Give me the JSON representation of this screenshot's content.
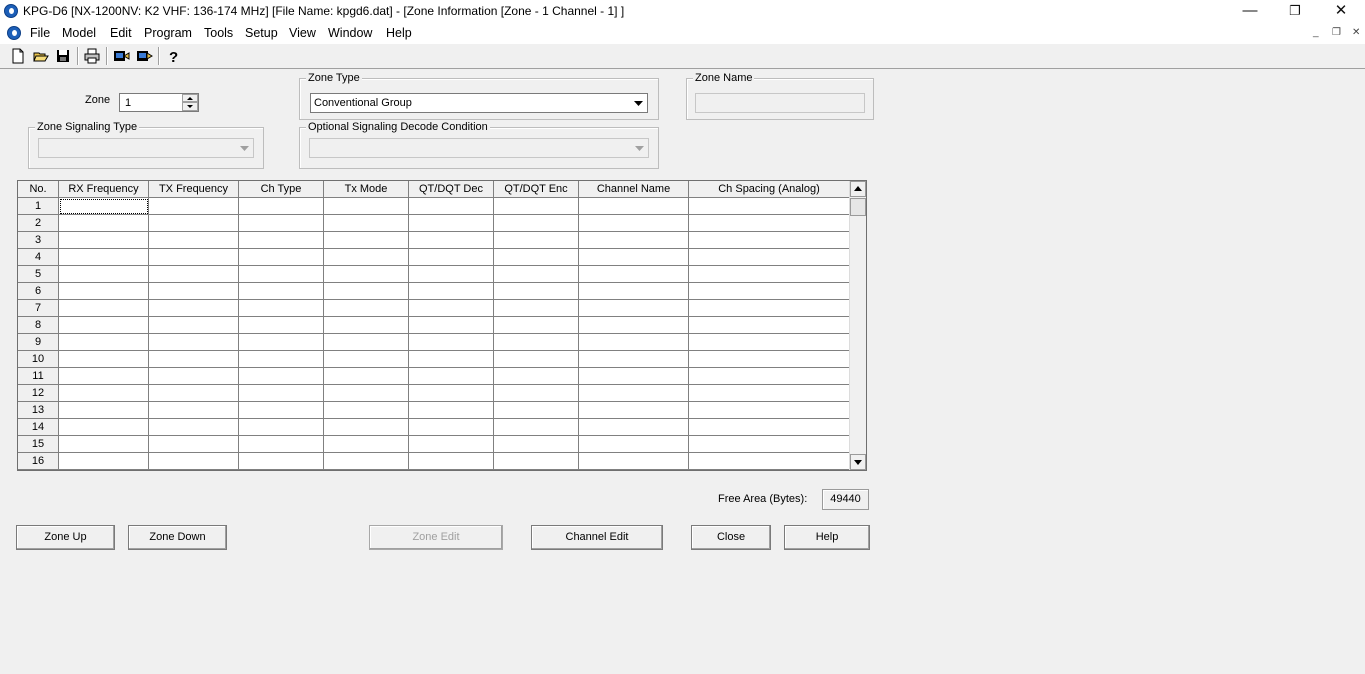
{
  "window": {
    "title": "KPG-D6 [NX-1200NV: K2 VHF: 136-174 MHz] [File Name: kpgd6.dat] - [Zone Information [Zone -  1    Channel   -   1]  ]",
    "minimize": "—",
    "restore": "❐",
    "close": "✕"
  },
  "menu": {
    "items": [
      "File",
      "Model",
      "Edit",
      "Program",
      "Tools",
      "Setup",
      "View",
      "Window",
      "Help"
    ],
    "mdi_minimize": "_",
    "mdi_restore": "❐",
    "mdi_close": "✕"
  },
  "toolbar": {
    "icons": [
      "new-file-icon",
      "open-folder-icon",
      "save-icon",
      "print-icon",
      "read-radio-icon",
      "write-radio-icon",
      "help-pointer-icon"
    ]
  },
  "zone": {
    "label": "Zone",
    "value": "1"
  },
  "zone_type": {
    "legend": "Zone Type",
    "value": "Conventional Group"
  },
  "zone_name": {
    "legend": "Zone Name",
    "value": ""
  },
  "zone_signaling_type": {
    "legend": "Zone Signaling Type",
    "value": ""
  },
  "optional_signaling": {
    "legend": "Optional Signaling Decode Condition",
    "value": ""
  },
  "grid": {
    "columns": [
      "No.",
      "RX Frequency",
      "TX Frequency",
      "Ch Type",
      "Tx Mode",
      "QT/DQT Dec",
      "QT/DQT Enc",
      "Channel Name",
      "Ch Spacing (Analog)"
    ],
    "rows": [
      "1",
      "2",
      "3",
      "4",
      "5",
      "6",
      "7",
      "8",
      "9",
      "10",
      "11",
      "12",
      "13",
      "14",
      "15",
      "16"
    ]
  },
  "free_area": {
    "label": "Free Area (Bytes):",
    "value": "49440"
  },
  "buttons": {
    "zone_up": "Zone Up",
    "zone_down": "Zone Down",
    "zone_edit": "Zone Edit",
    "channel_edit": "Channel Edit",
    "close": "Close",
    "help": "Help"
  }
}
